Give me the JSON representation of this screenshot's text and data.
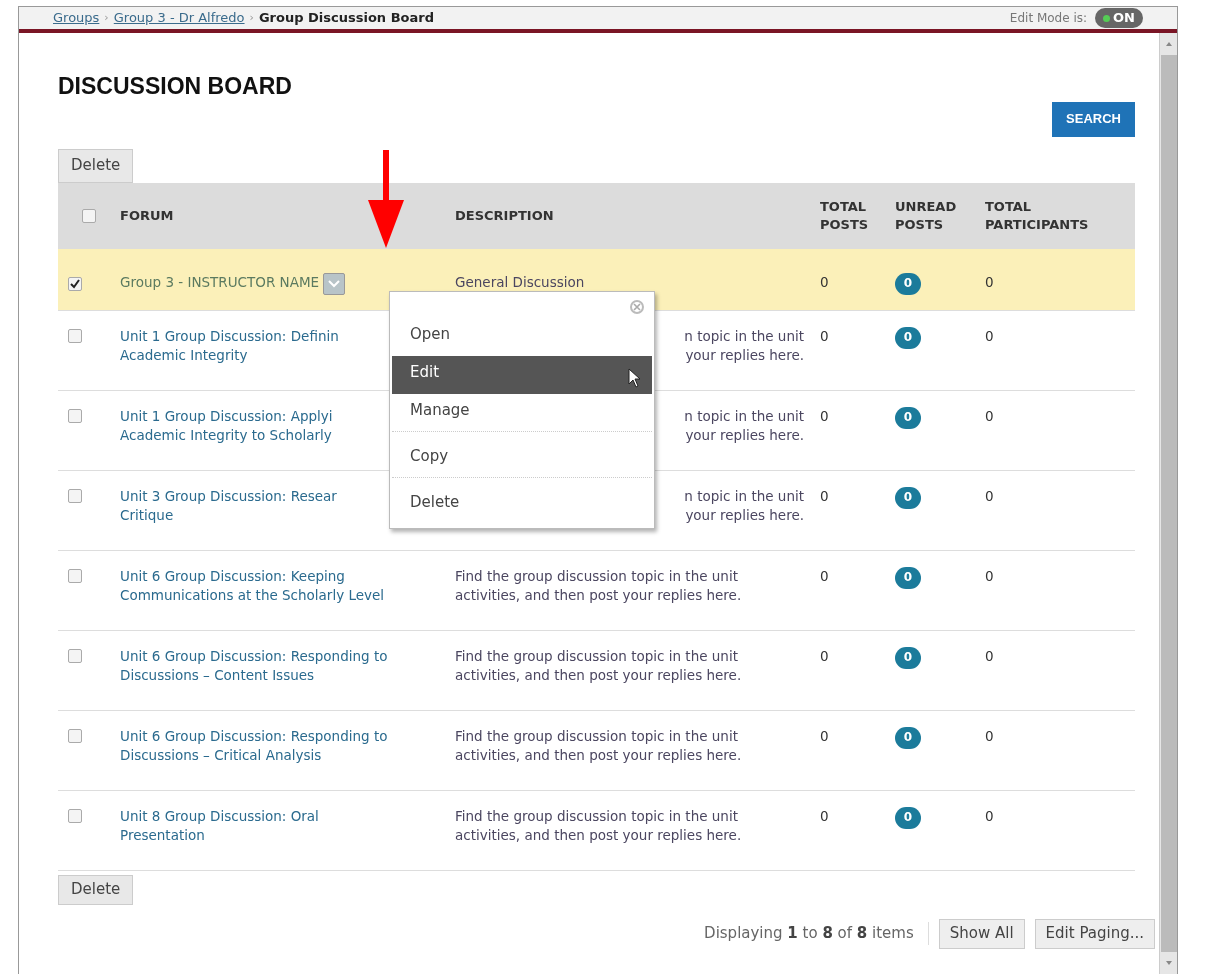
{
  "breadcrumb": [
    {
      "label": "Groups",
      "link": true
    },
    {
      "separator": "›",
      "label": "Group 3 - Dr Alfredo",
      "link": true
    },
    {
      "separator": "›",
      "label": "Group Discussion Board",
      "link": false
    }
  ],
  "edit_mode": {
    "label": "Edit Mode is:",
    "value": "ON",
    "on": true
  },
  "title": "DISCUSSION BOARD",
  "search_button": "SEARCH",
  "delete_button_top": "Delete",
  "table": {
    "columns": [
      "FORUM",
      "DESCRIPTION",
      "TOTAL POSTS",
      "UNREAD POSTS",
      "TOTAL PARTICIPANTS"
    ],
    "header_checked": false,
    "rows": [
      {
        "checked": true,
        "forum": [
          "Group 3 - INSTRUCTOR NAME"
        ],
        "description": [
          "General Discussion"
        ],
        "covered": false,
        "total_posts": "0",
        "unread_posts": "0",
        "total_participants": "0"
      },
      {
        "checked": false,
        "forum": [
          "Unit 1 Group Discussion: Definin",
          "Academic Integrity"
        ],
        "description": [
          "n topic in the unit",
          "your replies here."
        ],
        "covered": true,
        "total_posts": "0",
        "unread_posts": "0",
        "total_participants": "0"
      },
      {
        "checked": false,
        "forum": [
          "Unit 1 Group Discussion: Applyi",
          "Academic Integrity to Scholarly"
        ],
        "description": [
          "n topic in the unit",
          "your replies here."
        ],
        "covered": true,
        "total_posts": "0",
        "unread_posts": "0",
        "total_participants": "0"
      },
      {
        "checked": false,
        "forum": [
          "Unit 3 Group Discussion: Resear",
          "Critique"
        ],
        "description": [
          "n topic in the unit",
          "your replies here."
        ],
        "covered": true,
        "total_posts": "0",
        "unread_posts": "0",
        "total_participants": "0"
      },
      {
        "checked": false,
        "forum": [
          "Unit 6 Group Discussion: Keeping",
          "Communications at the Scholarly Level"
        ],
        "description": [
          "Find the group discussion topic in the unit",
          "activities, and then post your replies here."
        ],
        "covered": false,
        "total_posts": "0",
        "unread_posts": "0",
        "total_participants": "0"
      },
      {
        "checked": false,
        "forum": [
          "Unit 6 Group Discussion: Responding to",
          "Discussions – Content Issues"
        ],
        "description": [
          "Find the group discussion topic in the unit",
          "activities, and then post your replies here."
        ],
        "covered": false,
        "total_posts": "0",
        "unread_posts": "0",
        "total_participants": "0"
      },
      {
        "checked": false,
        "forum": [
          "Unit 6 Group Discussion: Responding to",
          "Discussions – Critical Analysis"
        ],
        "description": [
          "Find the group discussion topic in the unit",
          "activities, and then post your replies here."
        ],
        "covered": false,
        "total_posts": "0",
        "unread_posts": "0",
        "total_participants": "0"
      },
      {
        "checked": false,
        "forum": [
          "Unit 8 Group Discussion: Oral",
          "Presentation"
        ],
        "description": [
          "Find the group discussion topic in the unit",
          "activities, and then post your replies here."
        ],
        "covered": false,
        "total_posts": "0",
        "unread_posts": "0",
        "total_participants": "0"
      }
    ]
  },
  "context_menu": {
    "items": [
      {
        "label": "Open",
        "selected": false,
        "divider_after": false
      },
      {
        "label": "Edit",
        "selected": true,
        "divider_after": false
      },
      {
        "label": "Manage",
        "selected": false,
        "divider_after": true
      },
      {
        "label": "Copy",
        "selected": false,
        "divider_after": true
      },
      {
        "label": "Delete",
        "selected": false,
        "divider_after": false
      }
    ]
  },
  "delete_button_bottom": "Delete",
  "footer": {
    "display": [
      "Displaying ",
      "1",
      " to ",
      "8",
      " of ",
      "8",
      " items"
    ],
    "show_all": "Show All",
    "edit_paging": "Edit Paging..."
  }
}
